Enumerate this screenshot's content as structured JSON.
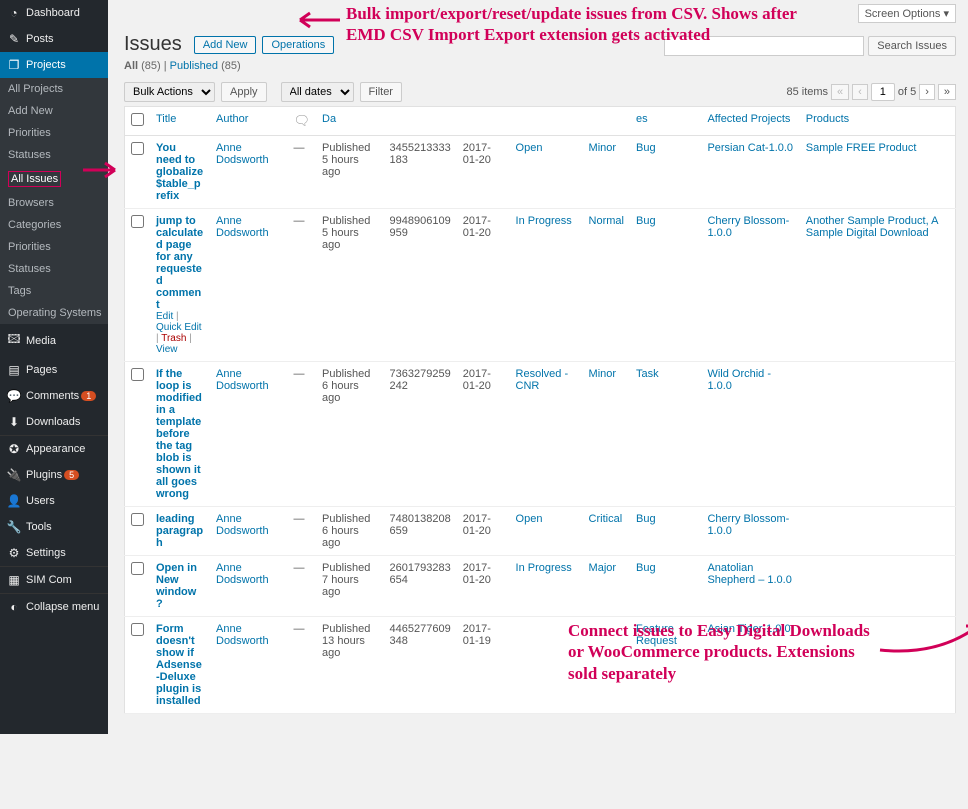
{
  "topbar": {
    "screen_options": "Screen Options ▾"
  },
  "sidebar": {
    "items": [
      {
        "icon": "◔",
        "label": "Dashboard"
      },
      {
        "icon": "✎",
        "label": "Posts"
      },
      {
        "icon": "❐",
        "label": "Projects",
        "current": true
      },
      {
        "icon": "🖾",
        "label": "Media"
      },
      {
        "icon": "▤",
        "label": "Pages"
      },
      {
        "icon": "💬",
        "label": "Comments",
        "badge": "1"
      },
      {
        "icon": "⬇",
        "label": "Downloads"
      },
      {
        "icon": "✪",
        "label": "Appearance"
      },
      {
        "icon": "🔌",
        "label": "Plugins",
        "badge": "5"
      },
      {
        "icon": "👤",
        "label": "Users"
      },
      {
        "icon": "🔧",
        "label": "Tools"
      },
      {
        "icon": "⚙",
        "label": "Settings"
      },
      {
        "icon": "▦",
        "label": "SIM Com"
      },
      {
        "icon": "◐",
        "label": "Collapse menu"
      }
    ],
    "submenu": [
      "All Projects",
      "Add New",
      "Priorities",
      "Statuses",
      "All Issues",
      "Browsers",
      "Categories",
      "Priorities",
      "Statuses",
      "Tags",
      "Operating Systems"
    ],
    "submenu_current_index": 4
  },
  "header": {
    "title": "Issues",
    "add_new": "Add New",
    "operations": "Operations"
  },
  "subsubsub": {
    "all_label": "All",
    "all_count": "(85)",
    "pub_label": "Published",
    "pub_count": "(85)"
  },
  "search": {
    "button": "Search Issues",
    "value": ""
  },
  "filters": {
    "bulk_actions": "Bulk Actions",
    "apply": "Apply",
    "all_dates": "All dates",
    "filter": "Filter"
  },
  "pager": {
    "total": "85 items",
    "page": "1",
    "of": "of 5"
  },
  "columns": [
    "Title",
    "Author",
    "",
    "Da",
    "",
    "",
    "",
    "",
    "es",
    "Affected Projects",
    "Products"
  ],
  "rows": [
    {
      "title": "You need to globalize $table_prefix",
      "author": "Anne Dodsworth",
      "comments": "—",
      "pub": "Published",
      "pub_sub": "5 hours ago",
      "id": "3455213333183",
      "date": "2017-01-20",
      "status": "Open",
      "priority": "Minor",
      "type": "Bug",
      "project": "Persian Cat-1.0.0",
      "product": "Sample FREE Product",
      "row_actions": null
    },
    {
      "title": "jump to calculated page for any requested comment",
      "author": "Anne Dodsworth",
      "comments": "—",
      "pub": "Published",
      "pub_sub": "5 hours ago",
      "id": "9948906109959",
      "date": "2017-01-20",
      "status": "In Progress",
      "priority": "Normal",
      "type": "Bug",
      "project": "Cherry Blossom-1.0.0",
      "product": "Another Sample Product, A Sample Digital Download",
      "row_actions": {
        "edit": "Edit",
        "quick": "Quick Edit",
        "trash": "Trash",
        "view": "View"
      }
    },
    {
      "title": "If the loop is modified in a template before the tag blob is shown it all goes wrong",
      "author": "Anne Dodsworth",
      "comments": "—",
      "pub": "Published",
      "pub_sub": "6 hours ago",
      "id": "7363279259242",
      "date": "2017-01-20",
      "status": "Resolved - CNR",
      "priority": "Minor",
      "type": "Task",
      "project": "Wild Orchid - 1.0.0",
      "product": "",
      "row_actions": null
    },
    {
      "title": "leading paragraph",
      "author": "Anne Dodsworth",
      "comments": "—",
      "pub": "Published",
      "pub_sub": "6 hours ago",
      "id": "7480138208659",
      "date": "2017-01-20",
      "status": "Open",
      "priority": "Critical",
      "type": "Bug",
      "project": "Cherry Blossom-1.0.0",
      "product": "",
      "row_actions": null
    },
    {
      "title": "Open in New window ?",
      "author": "Anne Dodsworth",
      "comments": "—",
      "pub": "Published",
      "pub_sub": "7 hours ago",
      "id": "2601793283654",
      "date": "2017-01-20",
      "status": "In Progress",
      "priority": "Major",
      "type": "Bug",
      "project": "Anatolian Shepherd – 1.0.0",
      "product": "",
      "row_actions": null
    },
    {
      "title": "Form doesn't show if Adsense-Deluxe plugin is installed",
      "author": "Anne Dodsworth",
      "comments": "—",
      "pub": "Published",
      "pub_sub": "13 hours ago",
      "id": "4465277609348",
      "date": "2017-01-19",
      "status": "",
      "priority": "",
      "type": "Feature Request",
      "project": "Asian Tiger-1.0.0",
      "product": "",
      "row_actions": null
    }
  ],
  "annotations": {
    "top": "Bulk import/export/reset/update issues from CSV. Shows after EMD CSV Import Export extension gets activated",
    "bottom": "Connect issues to Easy Digital Downloads or WooCommerce products. Extensions sold separately"
  }
}
